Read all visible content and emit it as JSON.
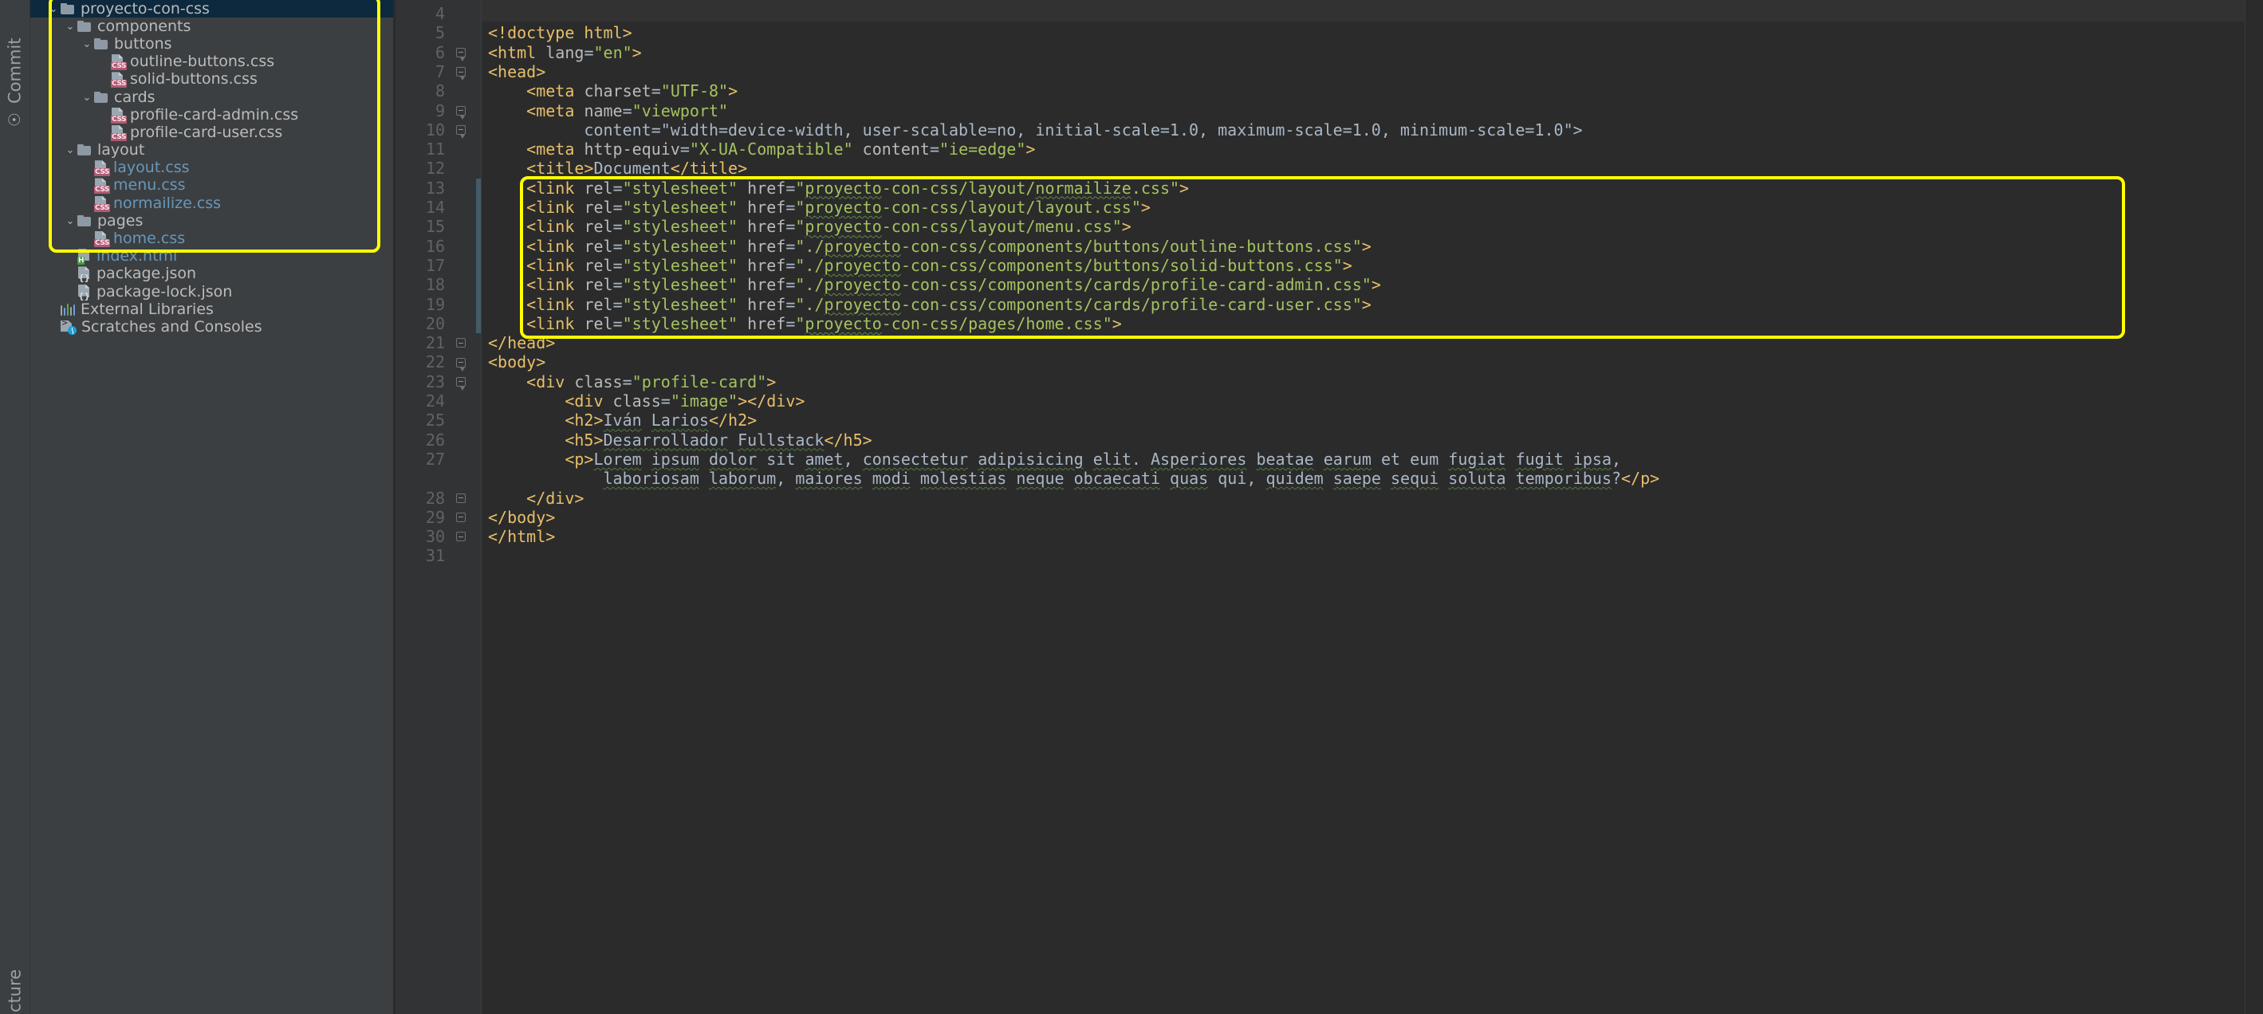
{
  "tool_strip": {
    "commit_label": "Commit",
    "commit_icon": "git-commit-icon",
    "structure_label": "cture"
  },
  "project_tree": {
    "rows": [
      {
        "label": "proyecto-con-css",
        "indent": 0,
        "kind": "folder",
        "twist": "⌄",
        "selected": true,
        "blue": false
      },
      {
        "label": "components",
        "indent": 1,
        "kind": "folder",
        "twist": "⌄",
        "selected": false,
        "blue": false
      },
      {
        "label": "buttons",
        "indent": 2,
        "kind": "folder",
        "twist": "⌄",
        "selected": false,
        "blue": false
      },
      {
        "label": "outline-buttons.css",
        "indent": 3,
        "kind": "css",
        "twist": "",
        "selected": false,
        "blue": false
      },
      {
        "label": "solid-buttons.css",
        "indent": 3,
        "kind": "css",
        "twist": "",
        "selected": false,
        "blue": false
      },
      {
        "label": "cards",
        "indent": 2,
        "kind": "folder",
        "twist": "⌄",
        "selected": false,
        "blue": false
      },
      {
        "label": "profile-card-admin.css",
        "indent": 3,
        "kind": "css",
        "twist": "",
        "selected": false,
        "blue": false
      },
      {
        "label": "profile-card-user.css",
        "indent": 3,
        "kind": "css",
        "twist": "",
        "selected": false,
        "blue": false
      },
      {
        "label": "layout",
        "indent": 1,
        "kind": "folder",
        "twist": "⌄",
        "selected": false,
        "blue": false
      },
      {
        "label": "layout.css",
        "indent": 2,
        "kind": "css",
        "twist": "",
        "selected": false,
        "blue": true
      },
      {
        "label": "menu.css",
        "indent": 2,
        "kind": "css",
        "twist": "",
        "selected": false,
        "blue": true
      },
      {
        "label": "normailize.css",
        "indent": 2,
        "kind": "css",
        "twist": "",
        "selected": false,
        "blue": true
      },
      {
        "label": "pages",
        "indent": 1,
        "kind": "folder",
        "twist": "⌄",
        "selected": false,
        "blue": false
      },
      {
        "label": "home.css",
        "indent": 2,
        "kind": "css",
        "twist": "",
        "selected": false,
        "blue": true
      },
      {
        "label": "index.html",
        "indent": 1,
        "kind": "html",
        "twist": "",
        "selected": false,
        "blue": true
      },
      {
        "label": "package.json",
        "indent": 1,
        "kind": "json",
        "twist": "",
        "selected": false,
        "blue": false
      },
      {
        "label": "package-lock.json",
        "indent": 1,
        "kind": "json",
        "twist": "",
        "selected": false,
        "blue": false
      },
      {
        "label": "External Libraries",
        "indent": 0,
        "kind": "libs",
        "twist": "",
        "selected": false,
        "blue": false
      },
      {
        "label": "Scratches and Consoles",
        "indent": 0,
        "kind": "scratch",
        "twist": "",
        "selected": false,
        "blue": false
      }
    ]
  },
  "editor": {
    "line_numbers": [
      "4",
      "5",
      "6",
      "7",
      "8",
      "9",
      "10",
      "11",
      "12",
      "13",
      "14",
      "15",
      "16",
      "17",
      "18",
      "19",
      "20",
      "21",
      "22",
      "23",
      "24",
      "25",
      "26",
      "27",
      "28",
      "29",
      "30",
      "31"
    ],
    "lines": [
      {
        "n": "4",
        "text": ""
      },
      {
        "n": "5",
        "text": "<!doctype html>"
      },
      {
        "n": "6",
        "text": "<html lang=\"en\">"
      },
      {
        "n": "7",
        "text": "<head>"
      },
      {
        "n": "8",
        "text": "    <meta charset=\"UTF-8\">"
      },
      {
        "n": "9",
        "text": "    <meta name=\"viewport\""
      },
      {
        "n": "10",
        "text": "          content=\"width=device-width, user-scalable=no, initial-scale=1.0, maximum-scale=1.0, minimum-scale=1.0\">"
      },
      {
        "n": "11",
        "text": "    <meta http-equiv=\"X-UA-Compatible\" content=\"ie=edge\">"
      },
      {
        "n": "12",
        "text": "    <title>Document</title>"
      },
      {
        "n": "13",
        "text": "    <link rel=\"stylesheet\" href=\"proyecto-con-css/layout/normailize.css\">"
      },
      {
        "n": "14",
        "text": "    <link rel=\"stylesheet\" href=\"proyecto-con-css/layout/layout.css\">"
      },
      {
        "n": "15",
        "text": "    <link rel=\"stylesheet\" href=\"proyecto-con-css/layout/menu.css\">"
      },
      {
        "n": "16",
        "text": "    <link rel=\"stylesheet\" href=\"./proyecto-con-css/components/buttons/outline-buttons.css\">"
      },
      {
        "n": "17",
        "text": "    <link rel=\"stylesheet\" href=\"./proyecto-con-css/components/buttons/solid-buttons.css\">"
      },
      {
        "n": "18",
        "text": "    <link rel=\"stylesheet\" href=\"./proyecto-con-css/components/cards/profile-card-admin.css\">"
      },
      {
        "n": "19",
        "text": "    <link rel=\"stylesheet\" href=\"./proyecto-con-css/components/cards/profile-card-user.css\">"
      },
      {
        "n": "20",
        "text": "    <link rel=\"stylesheet\" href=\"proyecto-con-css/pages/home.css\">"
      },
      {
        "n": "21",
        "text": "</head>"
      },
      {
        "n": "22",
        "text": "<body>"
      },
      {
        "n": "23",
        "text": "    <div class=\"profile-card\">"
      },
      {
        "n": "24",
        "text": "        <div class=\"image\"></div>"
      },
      {
        "n": "25",
        "text": "        <h2>Iván Larios</h2>"
      },
      {
        "n": "26",
        "text": "        <h5>Desarrollador Fullstack</h5>"
      },
      {
        "n": "27",
        "text": "        <p>Lorem ipsum dolor sit amet, consectetur adipisicing elit. Asperiores beatae earum et eum fugiat fugit ipsa, laboriosam laborum, maiores modi molestias neque obcaecati quas qui, quidem saepe sequi soluta temporibus?</p>"
      },
      {
        "n": "28",
        "text": "    </div>"
      },
      {
        "n": "29",
        "text": "</body>"
      },
      {
        "n": "30",
        "text": "</html>"
      },
      {
        "n": "31",
        "text": ""
      }
    ]
  },
  "colors": {
    "highlight": "#ffff00",
    "selection": "#0d293e",
    "editor_bg": "#2b2b2b",
    "gutter_bg": "#313335",
    "tree_bg": "#3c3f41",
    "tag": "#e8bf6a",
    "value": "#a5c261",
    "attr": "#bababa",
    "text": "#a9b7c6",
    "linenum": "#606366",
    "css_badge": "#b05a73",
    "html_badge": "#4a9a43",
    "change_marker": "#425b67"
  }
}
